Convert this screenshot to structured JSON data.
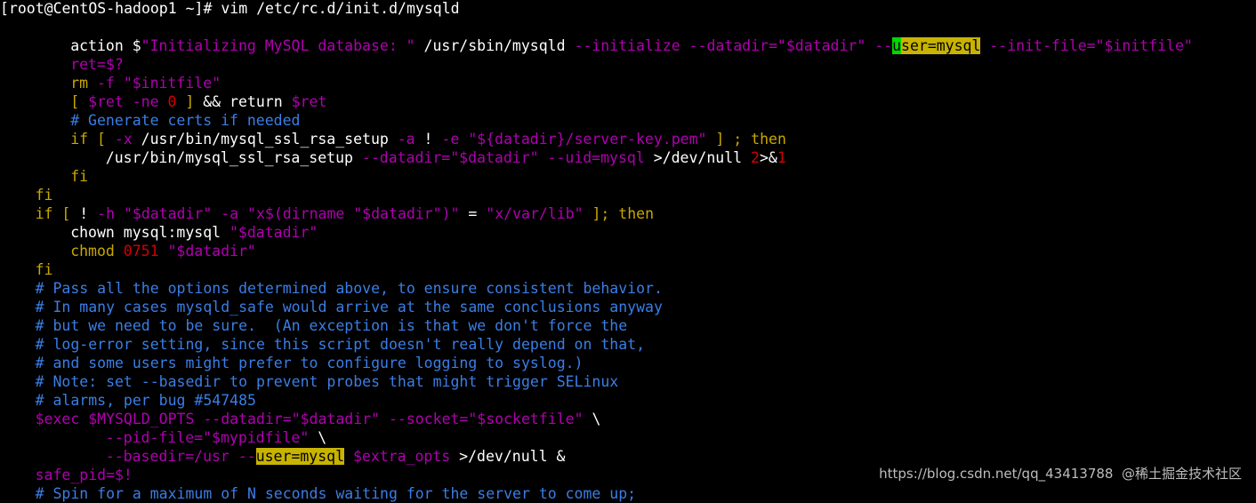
{
  "terminal": {
    "colors": {
      "background": "#000000",
      "default": "#ffffff",
      "keyword": "#c8a800",
      "string": "#b000b0",
      "option": "#b000b0",
      "comment": "#3a7ee6",
      "number": "#d60000",
      "highlight": "#c8b400",
      "cursor": "#00d700"
    },
    "lines": [
      {
        "indent": 0,
        "segs": [
          {
            "t": "[root@CentOS-hadoop1 ~]# vim /etc/rc.d/init.d/mysqld",
            "c": "default"
          }
        ]
      },
      {
        "indent": 0,
        "segs": []
      },
      {
        "indent": 2,
        "segs": [
          {
            "t": "action ",
            "c": "default"
          },
          {
            "t": "$",
            "c": "default"
          },
          {
            "t": "\"Initializing MySQL database: \"",
            "c": "string"
          },
          {
            "t": " /usr/sbin/mysqld ",
            "c": "default"
          },
          {
            "t": "--initialize --datadir=",
            "c": "option"
          },
          {
            "t": "\"$datadir\"",
            "c": "string"
          },
          {
            "t": " --",
            "c": "option"
          },
          {
            "t": "u",
            "c": "cursor"
          },
          {
            "t": "ser=mysql",
            "c": "highlight"
          },
          {
            "t": " --init-file=",
            "c": "option"
          },
          {
            "t": "\"$initfile\"",
            "c": "string"
          }
        ]
      },
      {
        "indent": 2,
        "segs": [
          {
            "t": "ret=",
            "c": "string"
          },
          {
            "t": "$?",
            "c": "string"
          }
        ]
      },
      {
        "indent": 2,
        "segs": [
          {
            "t": "rm ",
            "c": "keyword"
          },
          {
            "t": "-f ",
            "c": "option"
          },
          {
            "t": "\"$initfile\"",
            "c": "string"
          }
        ]
      },
      {
        "indent": 2,
        "segs": [
          {
            "t": "[ ",
            "c": "keyword"
          },
          {
            "t": "$ret",
            "c": "string"
          },
          {
            "t": " -ne ",
            "c": "option"
          },
          {
            "t": "0",
            "c": "number"
          },
          {
            "t": " ] ",
            "c": "keyword"
          },
          {
            "t": "&& return ",
            "c": "default"
          },
          {
            "t": "$ret",
            "c": "string"
          }
        ]
      },
      {
        "indent": 2,
        "segs": [
          {
            "t": "# Generate certs if needed",
            "c": "comment"
          }
        ]
      },
      {
        "indent": 2,
        "segs": [
          {
            "t": "if [ ",
            "c": "keyword"
          },
          {
            "t": "-x",
            "c": "option"
          },
          {
            "t": " /usr/bin/mysql_ssl_rsa_setup ",
            "c": "default"
          },
          {
            "t": "-a",
            "c": "option"
          },
          {
            "t": " ! ",
            "c": "default"
          },
          {
            "t": "-e",
            "c": "option"
          },
          {
            "t": " \"${datadir}/server-key.pem\"",
            "c": "string"
          },
          {
            "t": " ] ; then",
            "c": "keyword"
          }
        ]
      },
      {
        "indent": 3,
        "segs": [
          {
            "t": "/usr/bin/mysql_ssl_rsa_setup ",
            "c": "default"
          },
          {
            "t": "--datadir=",
            "c": "option"
          },
          {
            "t": "\"$datadir\"",
            "c": "string"
          },
          {
            "t": " --uid=mysql ",
            "c": "option"
          },
          {
            "t": ">/dev/null ",
            "c": "default"
          },
          {
            "t": "2",
            "c": "number"
          },
          {
            "t": ">&",
            "c": "default"
          },
          {
            "t": "1",
            "c": "number"
          }
        ]
      },
      {
        "indent": 2,
        "segs": [
          {
            "t": "fi",
            "c": "keyword"
          }
        ]
      },
      {
        "indent": 1,
        "segs": [
          {
            "t": "fi",
            "c": "keyword"
          }
        ]
      },
      {
        "indent": 1,
        "segs": [
          {
            "t": "if [ ",
            "c": "keyword"
          },
          {
            "t": "! ",
            "c": "default"
          },
          {
            "t": "-h",
            "c": "option"
          },
          {
            "t": " \"$datadir\"",
            "c": "string"
          },
          {
            "t": " -a",
            "c": "option"
          },
          {
            "t": " \"x$(dirname ",
            "c": "string"
          },
          {
            "t": "\"$datadir\"",
            "c": "string"
          },
          {
            "t": ")\"",
            "c": "string"
          },
          {
            "t": " = ",
            "c": "default"
          },
          {
            "t": "\"x/var/lib\"",
            "c": "string"
          },
          {
            "t": " ]; then",
            "c": "keyword"
          }
        ]
      },
      {
        "indent": 2,
        "segs": [
          {
            "t": "chown mysql:mysql ",
            "c": "default"
          },
          {
            "t": "\"$datadir\"",
            "c": "string"
          }
        ]
      },
      {
        "indent": 2,
        "segs": [
          {
            "t": "chmod ",
            "c": "keyword"
          },
          {
            "t": "0751",
            "c": "number"
          },
          {
            "t": " \"$datadir\"",
            "c": "string"
          }
        ]
      },
      {
        "indent": 1,
        "segs": [
          {
            "t": "fi",
            "c": "keyword"
          }
        ]
      },
      {
        "indent": 1,
        "segs": [
          {
            "t": "# Pass all the options determined above, to ensure consistent behavior.",
            "c": "comment"
          }
        ]
      },
      {
        "indent": 1,
        "segs": [
          {
            "t": "# In many cases mysqld_safe would arrive at the same conclusions anyway",
            "c": "comment"
          }
        ]
      },
      {
        "indent": 1,
        "segs": [
          {
            "t": "# but we need to be sure.  (An exception is that we don't force the",
            "c": "comment"
          }
        ]
      },
      {
        "indent": 1,
        "segs": [
          {
            "t": "# log-error setting, since this script doesn't really depend on that,",
            "c": "comment"
          }
        ]
      },
      {
        "indent": 1,
        "segs": [
          {
            "t": "# and some users might prefer to configure logging to syslog.)",
            "c": "comment"
          }
        ]
      },
      {
        "indent": 1,
        "segs": [
          {
            "t": "# Note: set --basedir to prevent probes that might trigger SELinux",
            "c": "comment"
          }
        ]
      },
      {
        "indent": 1,
        "segs": [
          {
            "t": "# alarms, per bug #547485",
            "c": "comment"
          }
        ]
      },
      {
        "indent": 1,
        "segs": [
          {
            "t": "$exec $MYSQLD_OPTS --datadir=",
            "c": "string"
          },
          {
            "t": "\"$datadir\"",
            "c": "string"
          },
          {
            "t": " --socket=",
            "c": "option"
          },
          {
            "t": "\"$socketfile\"",
            "c": "string"
          },
          {
            "t": " \\",
            "c": "default"
          }
        ]
      },
      {
        "indent": 3,
        "segs": [
          {
            "t": "--pid-file=",
            "c": "option"
          },
          {
            "t": "\"$mypidfile\"",
            "c": "string"
          },
          {
            "t": " \\",
            "c": "default"
          }
        ]
      },
      {
        "indent": 3,
        "segs": [
          {
            "t": "--basedir=/usr --",
            "c": "option"
          },
          {
            "t": "user=mysql",
            "c": "highlight"
          },
          {
            "t": " $extra_opts ",
            "c": "string"
          },
          {
            "t": ">/dev/null &",
            "c": "default"
          }
        ]
      },
      {
        "indent": 1,
        "segs": [
          {
            "t": "safe_pid=",
            "c": "string"
          },
          {
            "t": "$!",
            "c": "string"
          }
        ]
      },
      {
        "indent": 1,
        "segs": [
          {
            "t": "# Spin for a maximum of N seconds waiting for the server to come up;",
            "c": "comment"
          }
        ]
      }
    ]
  },
  "watermark": {
    "text": "https://blog.csdn.net/qq_43413788  @稀土掘金技术社区"
  }
}
